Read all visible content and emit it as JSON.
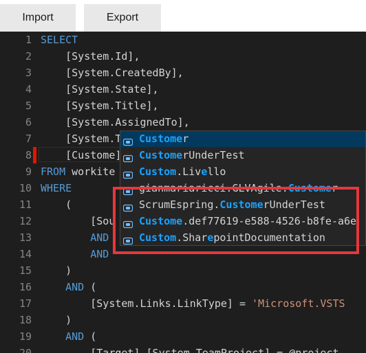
{
  "toolbar": {
    "import_label": "Import",
    "export_label": "Export"
  },
  "colors": {
    "keyword": "#569cd6",
    "string": "#ce9178",
    "match_highlight": "#18a3ff",
    "error": "#e51400",
    "callout_border": "#e5383b"
  },
  "editor": {
    "lines": [
      {
        "n": "1",
        "segs": [
          {
            "t": "SELECT",
            "c": "kw"
          }
        ]
      },
      {
        "n": "2",
        "segs": [
          {
            "t": "    [System.Id],",
            "c": ""
          }
        ]
      },
      {
        "n": "3",
        "segs": [
          {
            "t": "    [System.CreatedBy],",
            "c": ""
          }
        ]
      },
      {
        "n": "4",
        "segs": [
          {
            "t": "    [System.State],",
            "c": ""
          }
        ]
      },
      {
        "n": "5",
        "segs": [
          {
            "t": "    [System.Title],",
            "c": ""
          }
        ]
      },
      {
        "n": "6",
        "segs": [
          {
            "t": "    [System.AssignedTo],",
            "c": ""
          }
        ]
      },
      {
        "n": "7",
        "segs": [
          {
            "t": "    [System.Tags],",
            "c": ""
          }
        ]
      },
      {
        "n": "8",
        "segs": [
          {
            "t": "    [Custome]",
            "c": ""
          }
        ]
      },
      {
        "n": "9",
        "segs": [
          {
            "t": "FROM",
            "c": "kw"
          },
          {
            "t": " workite",
            "c": ""
          }
        ]
      },
      {
        "n": "10",
        "segs": [
          {
            "t": "WHERE",
            "c": "kw"
          }
        ]
      },
      {
        "n": "11",
        "segs": [
          {
            "t": "    (",
            "c": ""
          }
        ]
      },
      {
        "n": "12",
        "segs": [
          {
            "t": "        [Sou",
            "c": ""
          }
        ]
      },
      {
        "n": "13",
        "segs": [
          {
            "t": "        AND",
            "c": "kw"
          }
        ]
      },
      {
        "n": "14",
        "segs": [
          {
            "t": "        AND",
            "c": "kw"
          }
        ]
      },
      {
        "n": "15",
        "segs": [
          {
            "t": "    )",
            "c": ""
          }
        ]
      },
      {
        "n": "16",
        "segs": [
          {
            "t": "    ",
            "c": ""
          },
          {
            "t": "AND",
            "c": "kw"
          },
          {
            "t": " (",
            "c": ""
          }
        ]
      },
      {
        "n": "17",
        "segs": [
          {
            "t": "        [System.Links.LinkType] = ",
            "c": ""
          },
          {
            "t": "'Microsoft.VSTS",
            "c": "str"
          }
        ]
      },
      {
        "n": "18",
        "segs": [
          {
            "t": "    )",
            "c": ""
          }
        ]
      },
      {
        "n": "19",
        "segs": [
          {
            "t": "    ",
            "c": ""
          },
          {
            "t": "AND",
            "c": "kw"
          },
          {
            "t": " (",
            "c": ""
          }
        ]
      },
      {
        "n": "20",
        "segs": [
          {
            "t": "        [Target].[System.TeamProject] = @project",
            "c": ""
          }
        ]
      }
    ]
  },
  "autocomplete": {
    "icon": "field-icon",
    "items": [
      {
        "segs": [
          {
            "t": "Custome",
            "m": true
          },
          {
            "t": "r",
            "m": false
          }
        ],
        "selected": true
      },
      {
        "segs": [
          {
            "t": "Custome",
            "m": true
          },
          {
            "t": "rUnderTest",
            "m": false
          }
        ],
        "selected": false
      },
      {
        "segs": [
          {
            "t": "Custom",
            "m": true
          },
          {
            "t": ".Liv",
            "m": false
          },
          {
            "t": "e",
            "m": true
          },
          {
            "t": "llo",
            "m": false
          }
        ],
        "selected": false
      },
      {
        "segs": [
          {
            "t": "gianmariaricci.GLVAgile.",
            "m": false
          },
          {
            "t": "Custome",
            "m": true
          },
          {
            "t": "r",
            "m": false
          }
        ],
        "selected": false
      },
      {
        "segs": [
          {
            "t": "ScrumEspring.",
            "m": false
          },
          {
            "t": "Custome",
            "m": true
          },
          {
            "t": "rUnderTest",
            "m": false
          }
        ],
        "selected": false
      },
      {
        "segs": [
          {
            "t": "Custome",
            "m": true
          },
          {
            "t": ".def77619-e588-4526-b8fe-a6e",
            "m": false
          }
        ],
        "selected": false
      },
      {
        "segs": [
          {
            "t": "Custom",
            "m": true
          },
          {
            "t": ".Shar",
            "m": false
          },
          {
            "t": "e",
            "m": true
          },
          {
            "t": "pointDocumentation",
            "m": false
          }
        ],
        "selected": false
      }
    ]
  }
}
